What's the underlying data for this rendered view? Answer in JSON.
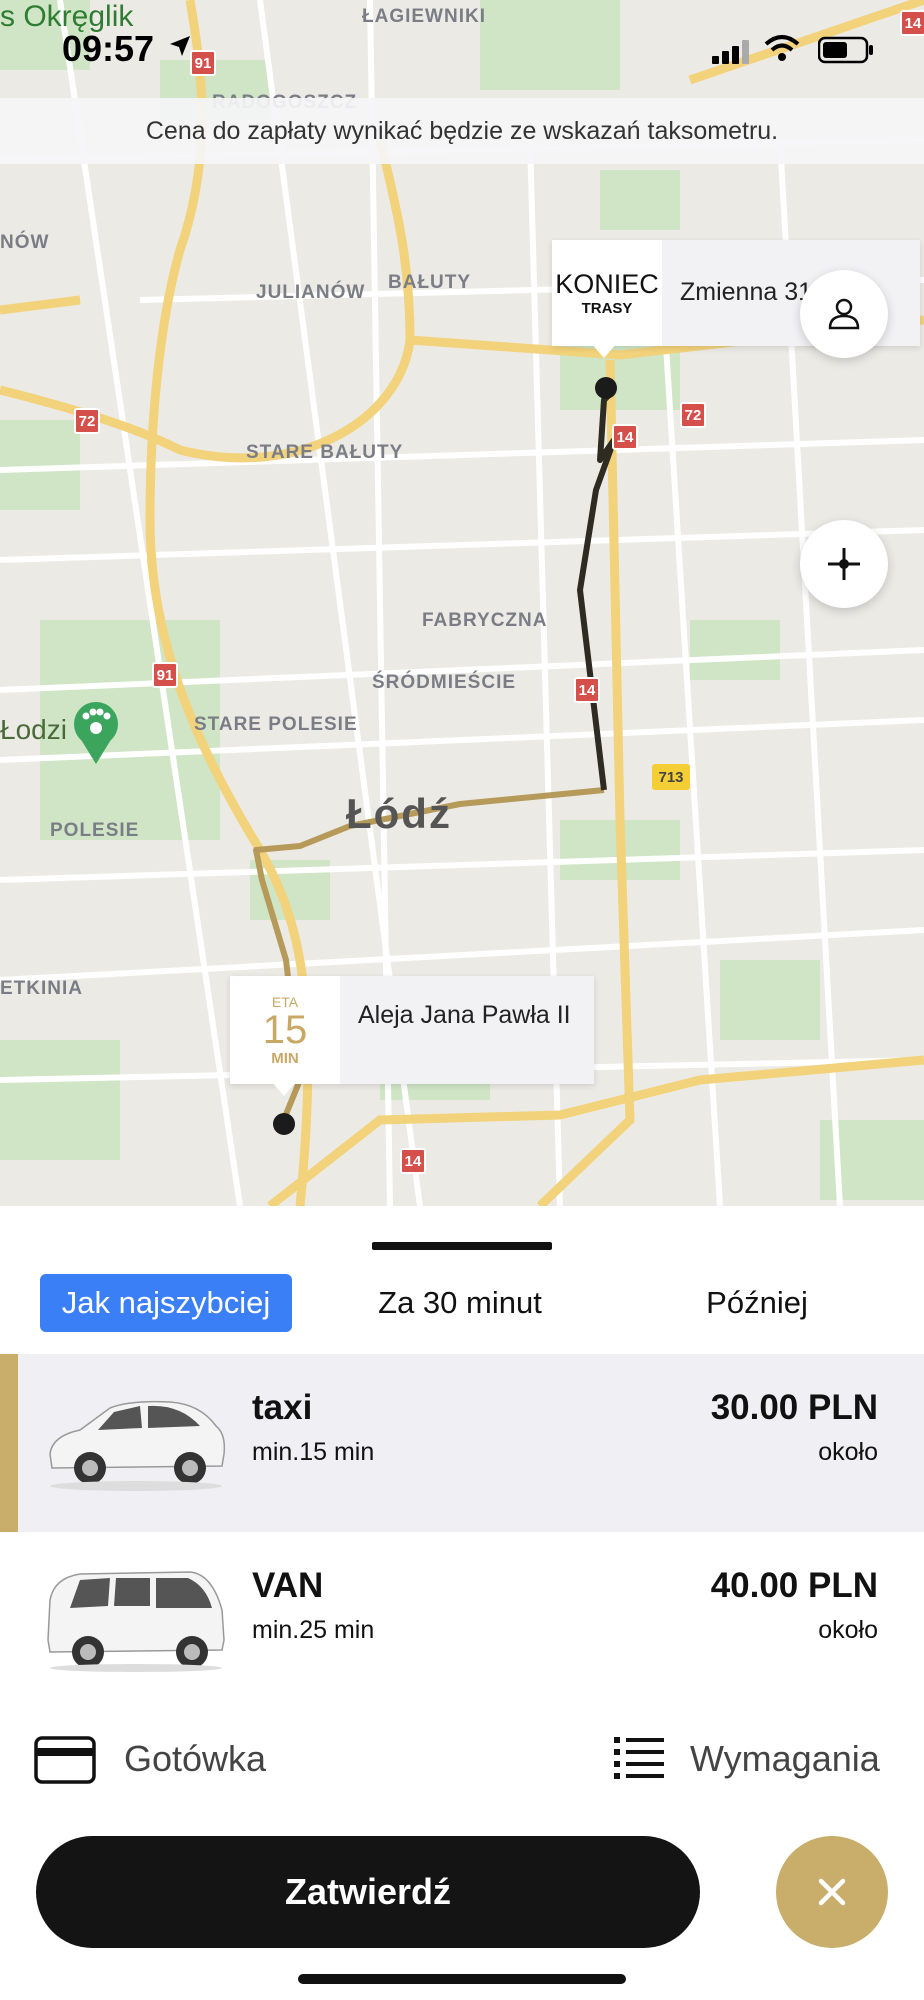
{
  "status_bar": {
    "time": "09:57"
  },
  "map": {
    "top_clip_label": "s Okręglik",
    "districts": [
      {
        "id": "lagiewniki",
        "label": "ŁAGIEWNIKI"
      },
      {
        "id": "radogoszcz",
        "label": "RADOGOSZCZ"
      },
      {
        "id": "julianow",
        "label": "JULIANÓW"
      },
      {
        "id": "baluty",
        "label": "BAŁUTY"
      },
      {
        "id": "stare-baluty",
        "label": "STARE BAŁUTY"
      },
      {
        "id": "fabryczna",
        "label": "FABRYCZNA"
      },
      {
        "id": "srodmiescie",
        "label": "ŚRÓDMIEŚCIE"
      },
      {
        "id": "stare-polesie",
        "label": "STARE POLESIE"
      },
      {
        "id": "polesie",
        "label": "POLESIE"
      },
      {
        "id": "now",
        "label": "NÓW"
      },
      {
        "id": "etkinia",
        "label": "ETKINIA"
      }
    ],
    "city_label": "Łódź",
    "zoo_label": "Łodzi",
    "road_shields": [
      "91",
      "72",
      "72",
      "14",
      "14",
      "14",
      "91",
      "713",
      "14"
    ],
    "end_callout": {
      "title": "KONIEC",
      "subtitle": "TRASY",
      "address": "Zmienna 31"
    },
    "start_callout": {
      "eta_label": "ETA",
      "eta_value": "15",
      "eta_unit": "MIN",
      "address": "Aleja Jana Pawła II"
    },
    "colors": {
      "route_dark": "#2e2b22",
      "route_gold": "#b69a5a"
    }
  },
  "banner": {
    "text": "Cena do zapłaty wynikać będzie ze wskazań taksometru."
  },
  "schedule_tabs": [
    {
      "label": "Jak najszybciej",
      "selected": true
    },
    {
      "label": "Za 30 minut",
      "selected": false
    },
    {
      "label": "Później",
      "selected": false
    }
  ],
  "vehicles": [
    {
      "name": "taxi",
      "eta": "min.15 min",
      "price": "30.00 PLN",
      "approx": "około",
      "selected": true,
      "icon": "sedan-car-icon"
    },
    {
      "name": "VAN",
      "eta": "min.25 min",
      "price": "40.00 PLN",
      "approx": "około",
      "selected": false,
      "icon": "van-icon"
    }
  ],
  "payment": {
    "method": "Gotówka",
    "icon": "credit-card-icon"
  },
  "requirements": {
    "label": "Wymagania",
    "icon": "list-icon"
  },
  "actions": {
    "confirm": "Zatwierdź",
    "cancel_icon": "close-icon"
  },
  "colors": {
    "accent_gold": "#c9ae6b",
    "tab_blue": "#3b7ff6",
    "dark": "#141414"
  }
}
